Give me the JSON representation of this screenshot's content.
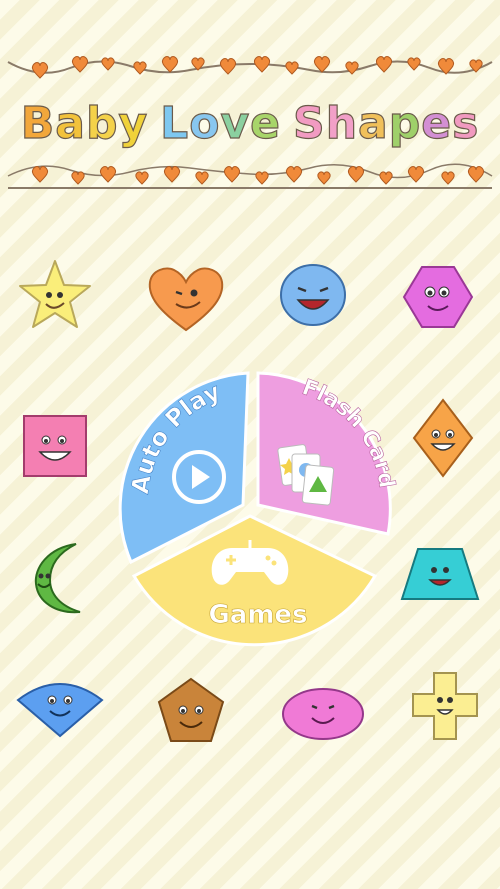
{
  "title": {
    "text": "Baby Love Shapes",
    "letter_colors": [
      "#f2a73b",
      "#f2c23b",
      "#f4d24a",
      "#f0d23a",
      "#ffffff",
      "#7ec8f0",
      "#88c7ef",
      "#8bd0a0",
      "#a8d56a",
      "#ffffff",
      "#f29bc2",
      "#f2a0c8",
      "#f0c05a",
      "#9fd06a",
      "#d38fd3",
      "#f19ac0"
    ]
  },
  "menu": {
    "auto_play": {
      "label": "Auto Play",
      "color": "#7ebef5"
    },
    "flash_card": {
      "label": "Flash Card",
      "color": "#ee9ee0"
    },
    "games": {
      "label": "Games",
      "color": "#fbe37a"
    }
  },
  "shapes": [
    {
      "name": "star",
      "color": "#faee7a"
    },
    {
      "name": "heart",
      "color": "#f79a4e"
    },
    {
      "name": "circle",
      "color": "#7fb8f0"
    },
    {
      "name": "hexagon",
      "color": "#e46ce0"
    },
    {
      "name": "square",
      "color": "#f47fb2"
    },
    {
      "name": "diamond",
      "color": "#f7a448"
    },
    {
      "name": "crescent",
      "color": "#5fb843"
    },
    {
      "name": "trapezoid",
      "color": "#36ced5"
    },
    {
      "name": "sector",
      "color": "#5c9ff0"
    },
    {
      "name": "pentagon",
      "color": "#c9843a"
    },
    {
      "name": "oval",
      "color": "#f07ad6"
    },
    {
      "name": "cross",
      "color": "#fbee92"
    }
  ]
}
